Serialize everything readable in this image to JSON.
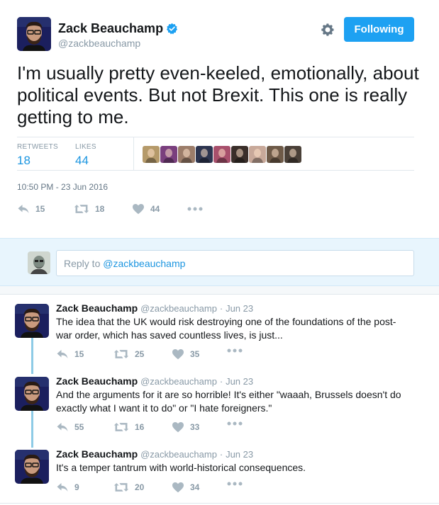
{
  "main_tweet": {
    "author_name": "Zack Beauchamp",
    "handle": "@zackbeauchamp",
    "follow_button": "Following",
    "text": "I'm usually pretty even-keeled, emotionally, about political events. But not Brexit. This one is really getting to me.",
    "retweets_label": "RETWEETS",
    "retweets_count": "18",
    "likes_label": "LIKES",
    "likes_count": "44",
    "timestamp": "10:50 PM - 23 Jun 2016",
    "actions": {
      "replies": "15",
      "retweets": "18",
      "likes": "44"
    },
    "liker_colors": [
      "#b59a6a",
      "#7a3f7e",
      "#9c7d6a",
      "#2d3550",
      "#a8506c",
      "#3a2e2a",
      "#c8a99a",
      "#6e5a48",
      "#4a4038"
    ]
  },
  "reply_box": {
    "placeholder_prefix": "Reply to ",
    "mention": "@zackbeauchamp"
  },
  "thread": [
    {
      "author_name": "Zack Beauchamp",
      "handle": "@zackbeauchamp",
      "separator": "·",
      "date": "Jun 23",
      "text": "The idea that the UK would risk destroying one of the foundations of the post-war order, which has saved countless lives, is just...",
      "replies": "15",
      "retweets": "25",
      "likes": "35"
    },
    {
      "author_name": "Zack Beauchamp",
      "handle": "@zackbeauchamp",
      "separator": "·",
      "date": "Jun 23",
      "text": "And the arguments for it are so horrible! It's either \"waaah, Brussels doesn't do exactly what I want it to do\" or \"I hate foreigners.\"",
      "replies": "55",
      "retweets": "16",
      "likes": "33"
    },
    {
      "author_name": "Zack Beauchamp",
      "handle": "@zackbeauchamp",
      "separator": "·",
      "date": "Jun 23",
      "text": "It's a temper tantrum with world-historical consequences.",
      "replies": "9",
      "retweets": "20",
      "likes": "34"
    }
  ],
  "icons": {
    "verified": "verified-badge-icon",
    "settings": "gear-icon",
    "reply": "reply-icon",
    "retweet": "retweet-icon",
    "like": "heart-icon",
    "more": "more-dots-icon"
  },
  "colors": {
    "accent": "#1da1f2",
    "link": "#1b95e0",
    "muted": "#8899a6",
    "reply_box_bg": "#e8f5fd",
    "thread_line": "#8ecbe6"
  }
}
